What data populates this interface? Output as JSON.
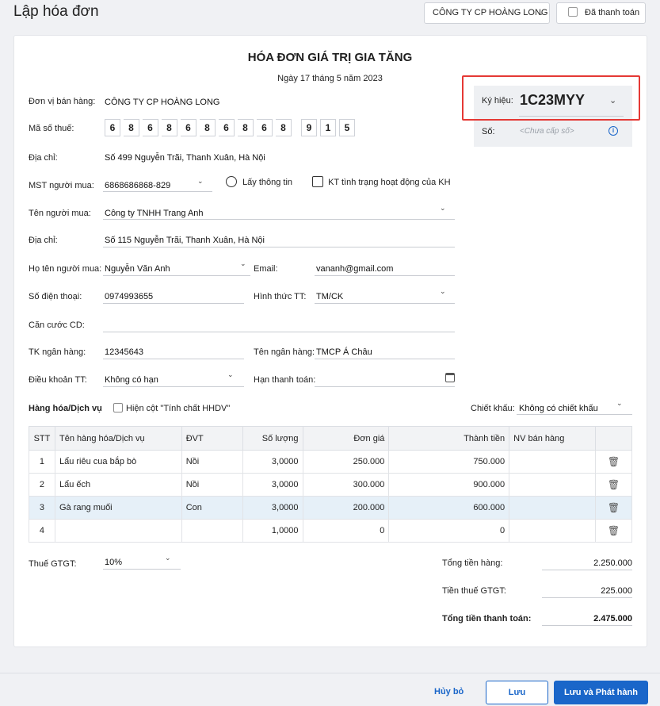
{
  "header": {
    "title": "Lập hóa đơn",
    "company_select": "CÔNG TY CP HOÀNG LONG",
    "paid_label": "Đã thanh toán"
  },
  "invoice": {
    "title": "HÓA ĐƠN GIÁ TRỊ GIA TĂNG",
    "date": "Ngày 17 tháng 5 năm 2023"
  },
  "symbol": {
    "label": "Ký hiệu:",
    "value": "1C23MYY",
    "number_label": "Số:",
    "number_placeholder": "<Chưa cấp số>"
  },
  "seller": {
    "unit_label": "Đơn vị bán hàng:",
    "unit_value": "CÔNG TY CP HOÀNG LONG",
    "tax_label": "Mã số thuế:",
    "tax_digits": [
      "6",
      "8",
      "6",
      "8",
      "6",
      "8",
      "6",
      "8",
      "6",
      "8"
    ],
    "tax_suffix": [
      "9",
      "1",
      "5"
    ],
    "address_label": "Địa chỉ:",
    "address_value": "Số 499 Nguyễn Trãi, Thanh Xuân, Hà Nội"
  },
  "buyer": {
    "mst_label": "MST người mua:",
    "mst_value": "6868686868-829",
    "fetch_info": "Lấy thông tin",
    "check_status": "KT tình trạng hoạt động của KH",
    "name_label": "Tên người mua:",
    "name_value": "Công ty TNHH Trang Anh",
    "address_label": "Địa chỉ:",
    "address_value": "Số 115 Nguyễn Trãi, Thanh Xuân, Hà Nội",
    "fullname_label": "Họ tên người mua:",
    "fullname_value": "Nguyễn Văn Anh",
    "email_label": "Email:",
    "email_value": "vananh@gmail.com",
    "phone_label": "Số điện thoại:",
    "phone_value": "0974993655",
    "payment_method_label": "Hình thức TT:",
    "payment_method_value": "TM/CK",
    "id_label": "Căn cước CD:",
    "bank_account_label": "TK ngân hàng:",
    "bank_account_value": "12345643",
    "bank_name_label": "Tên ngân hàng:",
    "bank_name_value": "TMCP Á Châu",
    "terms_label": "Điều khoản TT:",
    "terms_value": "Không có hạn",
    "due_label": "Hạn thanh toán:"
  },
  "goods": {
    "section_label": "Hàng hóa/Dịch vụ",
    "show_column_label": "Hiện cột \"Tính chất HHDV\"",
    "discount_label": "Chiết khấu:",
    "discount_value": "Không có chiết khấu",
    "columns": [
      "STT",
      "Tên hàng hóa/Dịch vụ",
      "ĐVT",
      "Số lượng",
      "Đơn giá",
      "Thành tiền",
      "NV bán hàng"
    ],
    "rows": [
      {
        "stt": "1",
        "name": "Lẩu riêu cua bắp bò",
        "unit": "Nồi",
        "qty": "3,0000",
        "price": "250.000",
        "amount": "750.000",
        "staff": ""
      },
      {
        "stt": "2",
        "name": "Lẩu ếch",
        "unit": "Nồi",
        "qty": "3,0000",
        "price": "300.000",
        "amount": "900.000",
        "staff": ""
      },
      {
        "stt": "3",
        "name": "Gà rang muối",
        "unit": "Con",
        "qty": "3,0000",
        "price": "200.000",
        "amount": "600.000",
        "staff": ""
      },
      {
        "stt": "4",
        "name": "",
        "unit": "",
        "qty": "1,0000",
        "price": "0",
        "amount": "0",
        "staff": ""
      }
    ]
  },
  "totals": {
    "vat_label": "Thuế GTGT:",
    "vat_value": "10%",
    "goods_total_label": "Tổng tiền hàng:",
    "goods_total_value": "2.250.000",
    "vat_amount_label": "Tiền thuế GTGT:",
    "vat_amount_value": "225.000",
    "grand_total_label": "Tổng tiền thanh toán:",
    "grand_total_value": "2.475.000"
  },
  "footer": {
    "cancel": "Hủy bỏ",
    "save": "Lưu",
    "save_issue": "Lưu và Phát hành"
  }
}
